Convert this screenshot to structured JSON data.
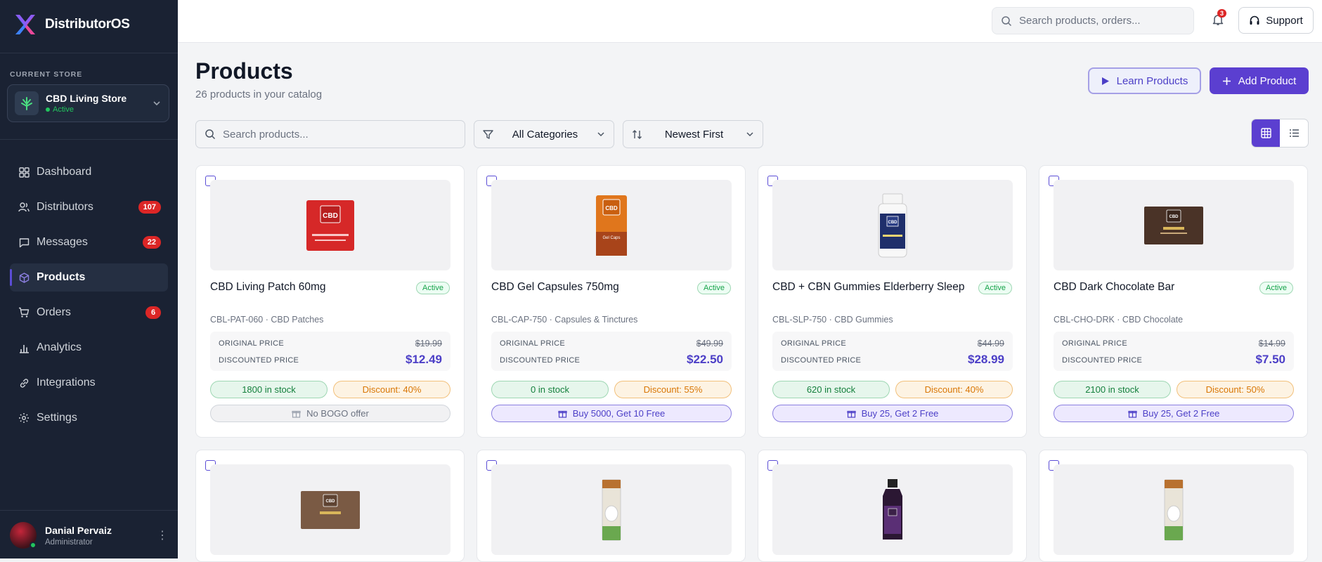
{
  "app": {
    "name": "DistributorOS"
  },
  "store": {
    "section_label": "CURRENT STORE",
    "name": "CBD Living Store",
    "status": "Active"
  },
  "nav": {
    "items": [
      {
        "label": "Dashboard",
        "icon": "dashboard-icon",
        "badge": ""
      },
      {
        "label": "Distributors",
        "icon": "users-icon",
        "badge": "107"
      },
      {
        "label": "Messages",
        "icon": "message-icon",
        "badge": "22"
      },
      {
        "label": "Products",
        "icon": "box-icon",
        "badge": "",
        "active": true
      },
      {
        "label": "Orders",
        "icon": "cart-icon",
        "badge": "6"
      },
      {
        "label": "Analytics",
        "icon": "chart-icon",
        "badge": ""
      },
      {
        "label": "Integrations",
        "icon": "link-icon",
        "badge": ""
      },
      {
        "label": "Settings",
        "icon": "gear-icon",
        "badge": ""
      }
    ]
  },
  "user": {
    "name": "Danial Pervaiz",
    "role": "Administrator"
  },
  "topbar": {
    "search_placeholder": "Search products, orders...",
    "notification_count": "3",
    "support_label": "Support"
  },
  "page": {
    "title": "Products",
    "subtitle": "26 products in your catalog",
    "learn_label": "Learn Products",
    "add_label": "Add Product"
  },
  "filters": {
    "search_placeholder": "Search products...",
    "category": "All Categories",
    "sort": "Newest First"
  },
  "labels": {
    "original_price": "ORIGINAL PRICE",
    "discounted_price": "DISCOUNTED PRICE"
  },
  "products": [
    {
      "name": "CBD Living Patch 60mg",
      "status": "Active",
      "sku": "CBL-PAT-060 · CBD Patches",
      "original": "$19.99",
      "discounted": "$12.49",
      "stock": "1800 in stock",
      "discount": "Discount: 40%",
      "bogo": "No BOGO offer",
      "has_bogo": false,
      "pack_color": "#d62828"
    },
    {
      "name": "CBD Gel Capsules 750mg",
      "status": "Active",
      "sku": "CBL-CAP-750 · Capsules & Tinctures",
      "original": "$49.99",
      "discounted": "$22.50",
      "stock": "0 in stock",
      "discount": "Discount: 55%",
      "bogo": "Buy 5000, Get 10 Free",
      "has_bogo": true,
      "pack_color": "#e0761c"
    },
    {
      "name": "CBD + CBN Gummies Elderberry Sleep",
      "status": "Active",
      "sku": "CBL-SLP-750 · CBD Gummies",
      "original": "$44.99",
      "discounted": "$28.99",
      "stock": "620 in stock",
      "discount": "Discount: 40%",
      "bogo": "Buy 25, Get 2 Free",
      "has_bogo": true,
      "pack_color": "#1f2f6b"
    },
    {
      "name": "CBD Dark Chocolate Bar",
      "status": "Active",
      "sku": "CBL-CHO-DRK · CBD Chocolate",
      "original": "$14.99",
      "discounted": "$7.50",
      "stock": "2100 in stock",
      "discount": "Discount: 50%",
      "bogo": "Buy 25, Get 2 Free",
      "has_bogo": true,
      "pack_color": "#4a3327"
    }
  ],
  "products_row2": [
    {
      "pack_color": "#7a5a44"
    },
    {
      "pack_color": "#e9e4d8"
    },
    {
      "pack_color": "#3b2148"
    },
    {
      "pack_color": "#e9e4d8"
    }
  ]
}
